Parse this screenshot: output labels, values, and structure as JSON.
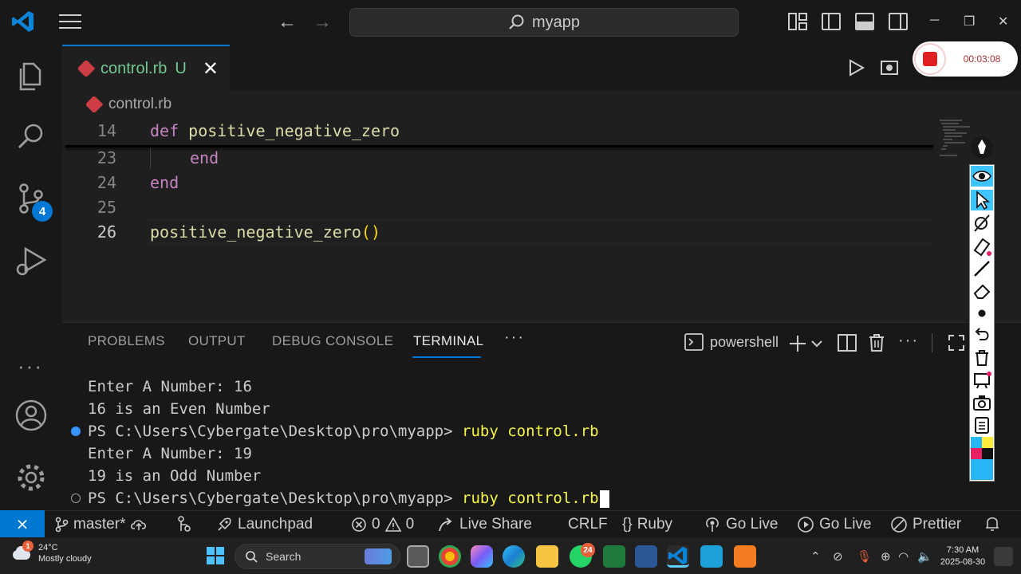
{
  "title_bar": {
    "search_text": "myapp",
    "back_arrow": "←",
    "forward_arrow": "→",
    "minimize": "─",
    "restore": "❐",
    "close": "✕"
  },
  "recording": {
    "time": "00:03:08"
  },
  "activity_bar": {
    "scm_badge": "4",
    "more": "···"
  },
  "editor_tab": {
    "filename": "control.rb",
    "status": "U",
    "close": "✕"
  },
  "breadcrumb": {
    "file": "control.rb"
  },
  "code_lines": [
    {
      "no": "14",
      "kw": "def",
      "rest": " positive_negative_zero"
    },
    {
      "no": "23",
      "kw": "end",
      "rest": ""
    },
    {
      "no": "24",
      "kw": "end",
      "rest": ""
    },
    {
      "no": "25",
      "kw": "",
      "rest": ""
    },
    {
      "no": "26",
      "fn": "positive_negative_zero",
      "paren": "()"
    }
  ],
  "panel": {
    "tabs": [
      "PROBLEMS",
      "OUTPUT",
      "DEBUG CONSOLE",
      "TERMINAL"
    ],
    "more": "···",
    "shell": "powershell",
    "actions_more": "···"
  },
  "terminal": {
    "line1": "Enter A Number: 16",
    "line2": "16 is an Even Number",
    "line3_prompt": "PS C:\\Users\\Cybergate\\Desktop\\pro\\myapp> ",
    "line3_cmd": "ruby control.rb",
    "line4": "Enter A Number: 19",
    "line5": "19 is an Odd Number",
    "line6_prompt": "PS C:\\Users\\Cybergate\\Desktop\\pro\\myapp> ",
    "line6_cmd": "ruby control.rb"
  },
  "status_bar": {
    "branch": "master*",
    "launchpad": "Launchpad",
    "errors": "0",
    "warnings": "0",
    "live_share": "Live Share",
    "eol": "CRLF",
    "language": "Ruby",
    "go_live_1": "Go Live",
    "go_live_2": "Go Live",
    "prettier": "Prettier"
  },
  "taskbar": {
    "temperature": "24°C",
    "weather": "Mostly cloudy",
    "weather_badge": "1",
    "search": "Search",
    "whatsapp_badge": "24",
    "time": "7:30 AM",
    "date": "2025-08-30"
  },
  "colors": {
    "accent": "#0078d4",
    "untracked": "#73c991",
    "keyword": "#c586c0",
    "function": "#dcdcaa",
    "command": "#f5f543",
    "record": "#e02020"
  }
}
